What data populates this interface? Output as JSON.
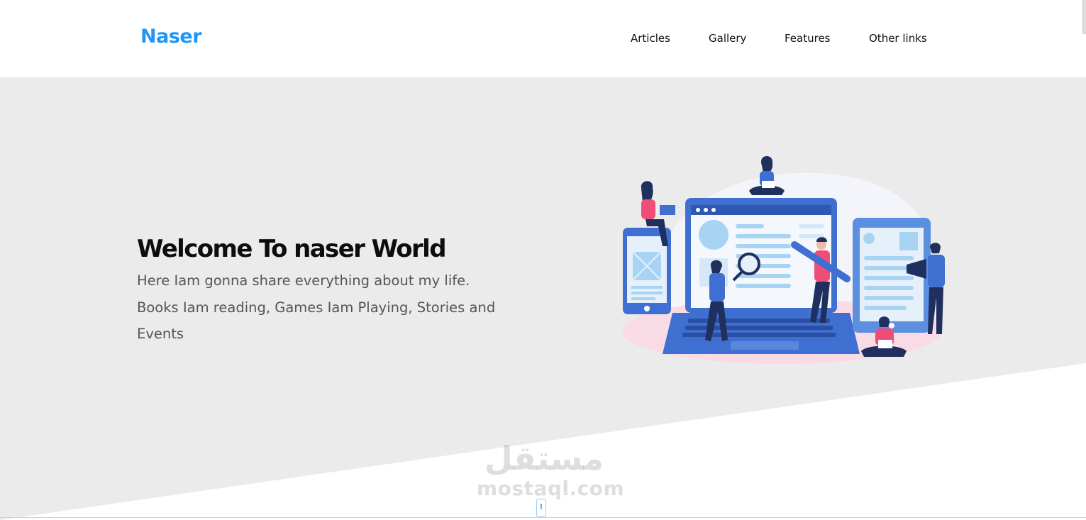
{
  "header": {
    "logo": "Naser",
    "nav": [
      {
        "label": "Articles"
      },
      {
        "label": "Gallery"
      },
      {
        "label": "Features"
      },
      {
        "label": "Other links"
      }
    ]
  },
  "hero": {
    "title": "Welcome To naser World",
    "text": "Here Iam gonna share everything about my life. Books Iam reading, Games Iam Playing, Stories and Events"
  },
  "watermark": {
    "arabic": "مستقل",
    "latin": "mostaql.com"
  },
  "colors": {
    "accent": "#2196f3",
    "hero_bg": "#ebebeb",
    "illustration_blue": "#3f6fd1",
    "illustration_pink": "#ef4d77",
    "illustration_light": "#a8d4f3"
  }
}
